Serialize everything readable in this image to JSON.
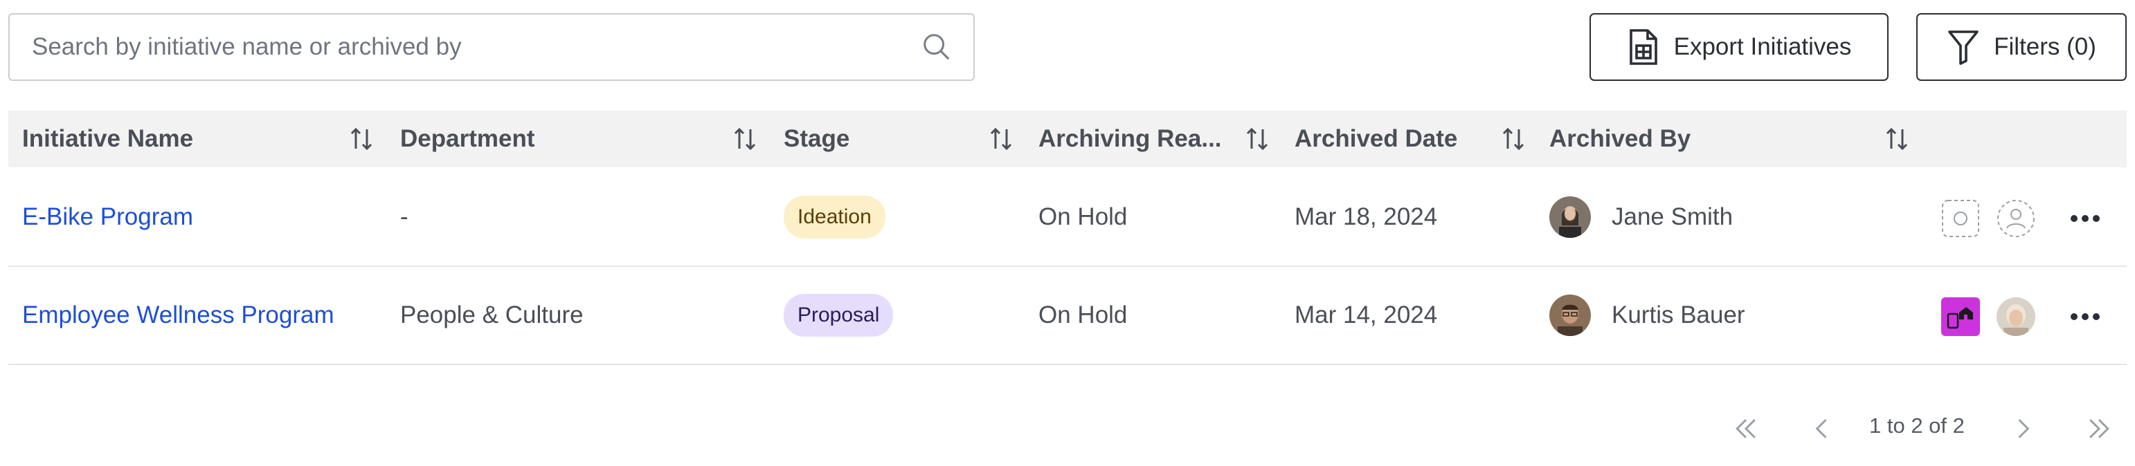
{
  "search": {
    "placeholder": "Search by initiative name or archived by",
    "icon": "search-icon"
  },
  "toolbar": {
    "export_label": "Export Initiatives",
    "filters_label": "Filters (0)"
  },
  "table": {
    "columns": [
      "Initiative Name",
      "Department",
      "Stage",
      "Archiving Rea...",
      "Archived Date",
      "Archived By"
    ],
    "rows": [
      {
        "name": "E-Bike Program",
        "department": "-",
        "stage": "Ideation",
        "reason": "On Hold",
        "date": "Mar 18, 2024",
        "archived_by": "Jane Smith"
      },
      {
        "name": "Employee Wellness Program",
        "department": "People & Culture",
        "stage": "Proposal",
        "reason": "On Hold",
        "date": "Mar 14, 2024",
        "archived_by": "Kurtis Bauer"
      }
    ]
  },
  "pagination": {
    "text": "1 to 2 of 2"
  },
  "colors": {
    "link": "#1d4ed8",
    "ideation_bg": "#fdefc7",
    "proposal_bg": "#e6dcfb",
    "badge_magenta": "#cc33dd"
  }
}
